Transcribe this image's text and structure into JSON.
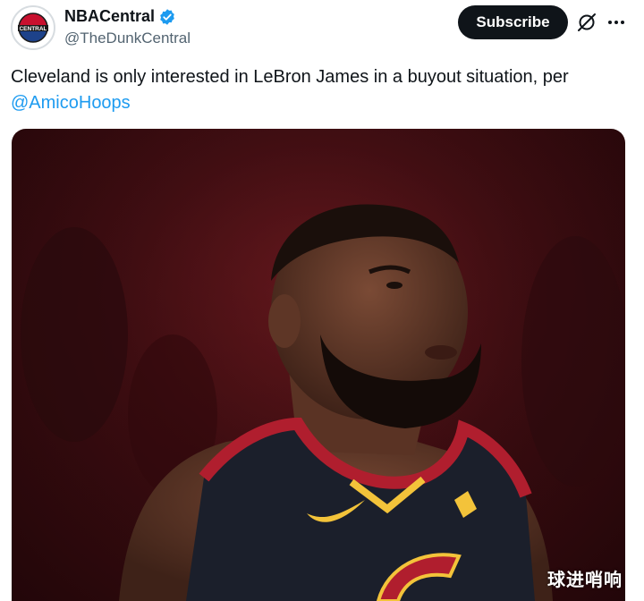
{
  "author": {
    "display_name": "NBACentral",
    "handle": "@TheDunkCentral",
    "verified": true,
    "avatar_text": "CENTRAL"
  },
  "actions": {
    "subscribe_label": "Subscribe",
    "grok_icon": "grok-icon",
    "more_icon": "more-icon"
  },
  "tweet": {
    "text": "Cleveland is only interested in LeBron James in a buyout situation, per",
    "mention": "@AmicoHoops"
  },
  "media": {
    "alt": "basketball player photo"
  },
  "watermark": "球进哨响",
  "colors": {
    "accent": "#1d9bf0",
    "subscribe_bg": "#0f1419",
    "verified": "#1d9bf0",
    "jersey": "#1b1f2b",
    "jersey_trim": "#b01e2e",
    "logo_gold": "#f3c33a"
  }
}
